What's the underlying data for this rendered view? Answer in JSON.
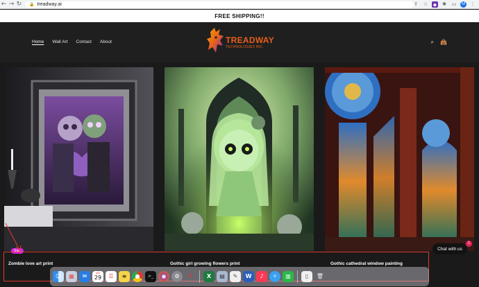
{
  "browser": {
    "url": "treadway.ai"
  },
  "announcement": {
    "text": "FREE SHIPPING!!"
  },
  "header": {
    "menu": [
      {
        "label": "Home",
        "active": true
      },
      {
        "label": "Wall Art",
        "active": false
      },
      {
        "label": "Contact",
        "active": false
      },
      {
        "label": "About",
        "active": false
      }
    ],
    "logo": {
      "main": "TREADWAY",
      "sub": "TECHNOLOGIES INC."
    },
    "icons": [
      "search-icon",
      "cart-icon"
    ]
  },
  "products": [
    {
      "title": "Zombie love art print",
      "badge": "Sale"
    },
    {
      "title": "Gothic girl growing flowers print",
      "badge": ""
    },
    {
      "title": "Gothic cathedral window painting",
      "badge": ""
    }
  ],
  "chat": {
    "label": "Chat with us",
    "badge": "1"
  },
  "dock": {
    "calendar_day": "29",
    "calendar_month": "JAN",
    "apps": [
      "finder-icon",
      "launchpad-icon",
      "mail-icon",
      "calendar-icon",
      "reminders-icon",
      "notes-icon",
      "chrome-icon",
      "terminal-icon",
      "firefox-icon",
      "system-preferences-icon",
      "help-icon",
      "separator",
      "excel-icon",
      "preview-icon",
      "pages-icon",
      "word-icon",
      "music-icon",
      "safari-icon",
      "numbers-icon",
      "separator",
      "notes-app-icon",
      "trash-icon"
    ]
  },
  "colors": {
    "accent": "#e8601c",
    "sale": "#d81ef0",
    "annotation": "#e03a2c"
  }
}
